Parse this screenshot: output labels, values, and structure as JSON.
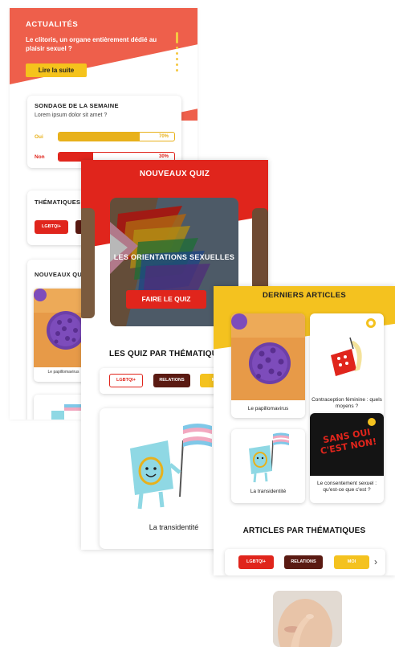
{
  "screen1": {
    "news_label": "ACTUALITÉS",
    "news_title": "Le clitoris, un organe entièrement dédié au plaisir sexuel ?",
    "read_more": "Lire la suite",
    "poll": {
      "title": "SONDAGE DE LA SEMAINE",
      "question": "Lorem ipsum dolor sit amet ?",
      "options": [
        {
          "label": "Oui",
          "percent_text": "70%",
          "value": 0.7,
          "color": "#e8b11b"
        },
        {
          "label": "Non",
          "percent_text": "30%",
          "value": 0.3,
          "color": "#e0251c"
        }
      ]
    },
    "themes_title": "THÉMATIQUES",
    "theme_chip": "LGBTQI+",
    "new_quiz_title": "NOUVEAUX QUIZ",
    "article_label": "Le papillomavirus"
  },
  "screen2": {
    "header": "NOUVEAUX QUIZ",
    "quiz_title": "LES ORIENTATIONS SEXUELLES",
    "quiz_button": "FAIRE LE QUIZ",
    "themes_title": "LES QUIZ PAR THÉMATIQUES",
    "chips": [
      {
        "label": "LGBTQI+",
        "style": "outline"
      },
      {
        "label": "RELATIONS",
        "style": "dark"
      },
      {
        "label": "MOI",
        "style": "yellow"
      }
    ],
    "card_label": "La transidentité"
  },
  "screen3": {
    "header": "DERNIERS ARTICLES",
    "articles": [
      {
        "label": "Le papillomavirus"
      },
      {
        "label": "Contraception féminine : quels moyens ?"
      },
      {
        "label": "La transidentité"
      },
      {
        "label": "Le consentement sexuel : qu'est-ce que c'est ?"
      }
    ],
    "consent_image_text": "SANS OUI C'EST NON!",
    "themes_title": "ARTICLES PAR THÉMATIQUES",
    "chips": [
      {
        "label": "LGBTQI+",
        "style": "red"
      },
      {
        "label": "RELATIONS",
        "style": "dark"
      },
      {
        "label": "MOI",
        "style": "yellow"
      }
    ],
    "arrow": "›"
  },
  "icons": {
    "chevron": "chevron-right-icon",
    "bookmark": "bookmark-icon"
  }
}
